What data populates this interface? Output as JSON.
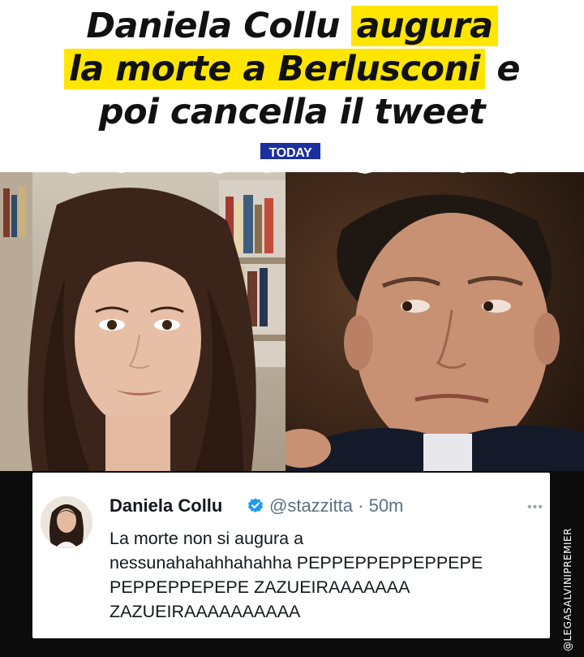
{
  "headline": {
    "line1_pre": "Daniela Collu ",
    "line1_highlight": "augura",
    "line2_highlight": "la morte a Berlusconi",
    "line2_post": " e",
    "line3": "poi cancella il tweet",
    "highlight_color": "#ffe600"
  },
  "brand": {
    "label": "TODAY",
    "color": "#1a2fa0"
  },
  "tweet": {
    "name": "Daniela Collu",
    "verified_icon": "verified-badge-icon",
    "handle": "@stazzitta · 50m",
    "text": "La morte non si augura a\nnessunahahahhahahha PEPPEPPEPPEPPEPE\nPEPPEPPEPEPE ZAZUEIRAAAAAAA\nZAZUEIRAAAAAAAAAA"
  },
  "watermark": "@LEGASALVINIPREMIER"
}
